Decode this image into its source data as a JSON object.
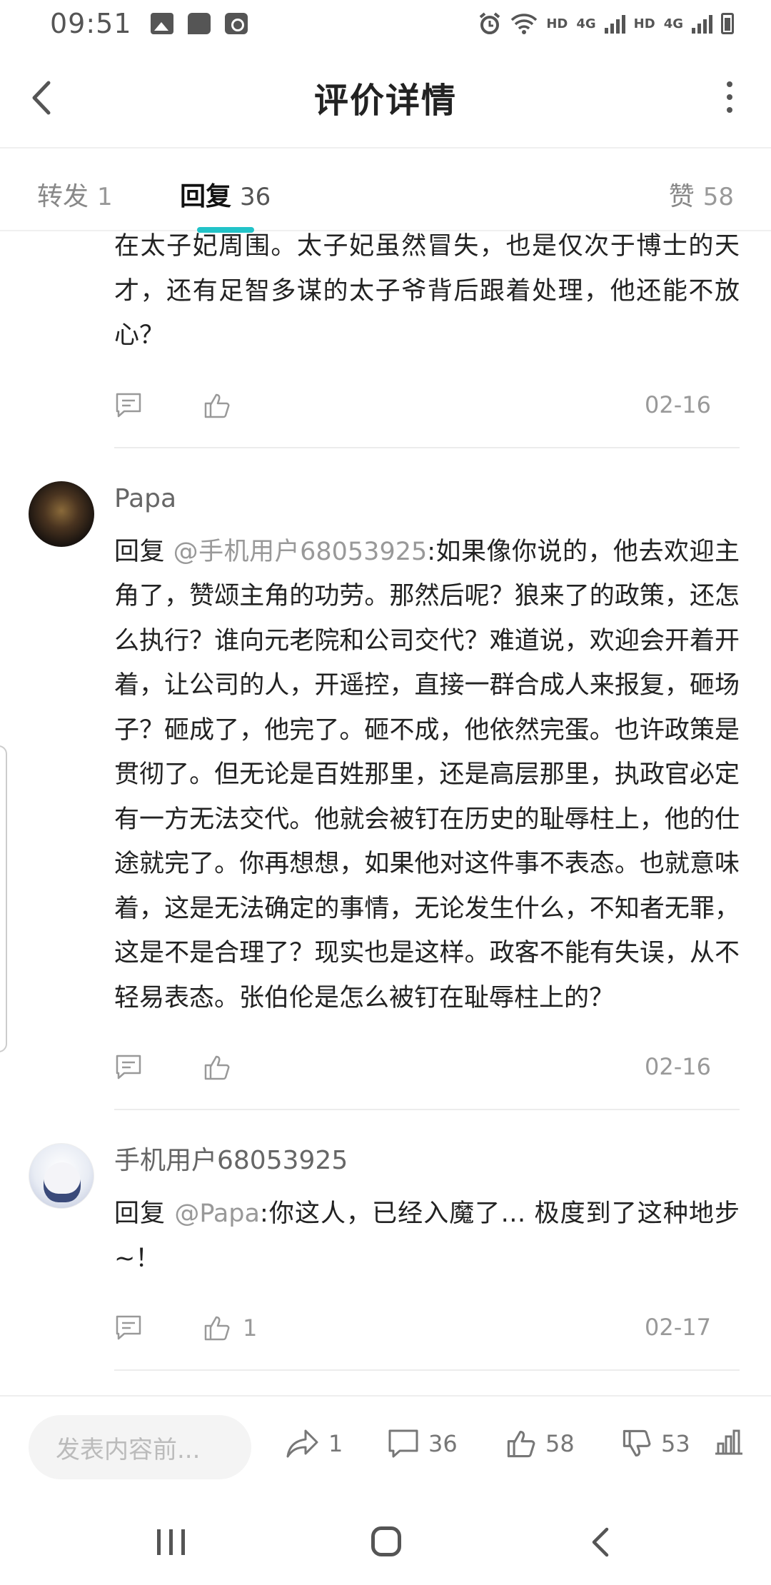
{
  "status_bar": {
    "time": "09:51",
    "left_icons": [
      "image-icon",
      "message-icon",
      "clock-icon"
    ],
    "right_icons": [
      "alarm-icon",
      "wifi-icon",
      "signal-icon",
      "signal-icon",
      "battery-icon"
    ],
    "hd1": "HD",
    "net1": "4G",
    "hd2": "HD",
    "net2": "4G"
  },
  "header": {
    "title": "评价详情",
    "back_icon": "chevron-left-icon",
    "more_icon": "more-vertical-icon"
  },
  "tabs": [
    {
      "label": "转发",
      "count": "1",
      "active": false
    },
    {
      "label": "回复",
      "count": "36",
      "active": true
    },
    {
      "label": "赞",
      "count": "58",
      "active": false
    }
  ],
  "comments": [
    {
      "username": "",
      "reply_prefix": "",
      "mention": "",
      "text": "在太子妃周围。太子妃虽然冒失，也是仅次于博士的天才，还有足智多谋的太子爷背后跟着处理，他还能不放心？",
      "like_count": "",
      "date": "02-16"
    },
    {
      "username": "Papa",
      "reply_prefix": "回复 ",
      "mention": "@手机用户68053925",
      "text": ":如果像你说的，他去欢迎主角了，赞颂主角的功劳。那然后呢？狼来了的政策，还怎么执行？谁向元老院和公司交代？难道说，欢迎会开着开着，让公司的人，开遥控，直接一群合成人来报复，砸场子？砸成了，他完了。砸不成，他依然完蛋。也许政策是贯彻了。但无论是百姓那里，还是高层那里，执政官必定有一方无法交代。他就会被钉在历史的耻辱柱上，他的仕途就完了。你再想想，如果他对这件事不表态。也就意味着，这是无法确定的事情，无论发生什么，不知者无罪，这是不是合理了？现实也是这样。政客不能有失误，从不轻易表态。张伯伦是怎么被钉在耻辱柱上的？",
      "like_count": "",
      "date": "02-16"
    },
    {
      "username": "手机用户68053925",
      "reply_prefix": "回复 ",
      "mention": "@Papa",
      "text": ":你这人，已经入魔了… 极度到了这种地步~！",
      "like_count": "1",
      "date": "02-17"
    }
  ],
  "bottom_bar": {
    "input_placeholder": "发表内容前...",
    "share_count": "1",
    "comment_count": "36",
    "like_count": "58",
    "dislike_count": "53",
    "share_icon": "share-arrow-icon",
    "comment_icon": "comment-icon",
    "like_icon": "thumbs-up-icon",
    "dislike_icon": "thumbs-down-icon",
    "stats_icon": "bar-chart-icon"
  },
  "colors": {
    "accent": "#22c3c8",
    "text_primary": "#222222",
    "text_secondary": "#999999"
  }
}
